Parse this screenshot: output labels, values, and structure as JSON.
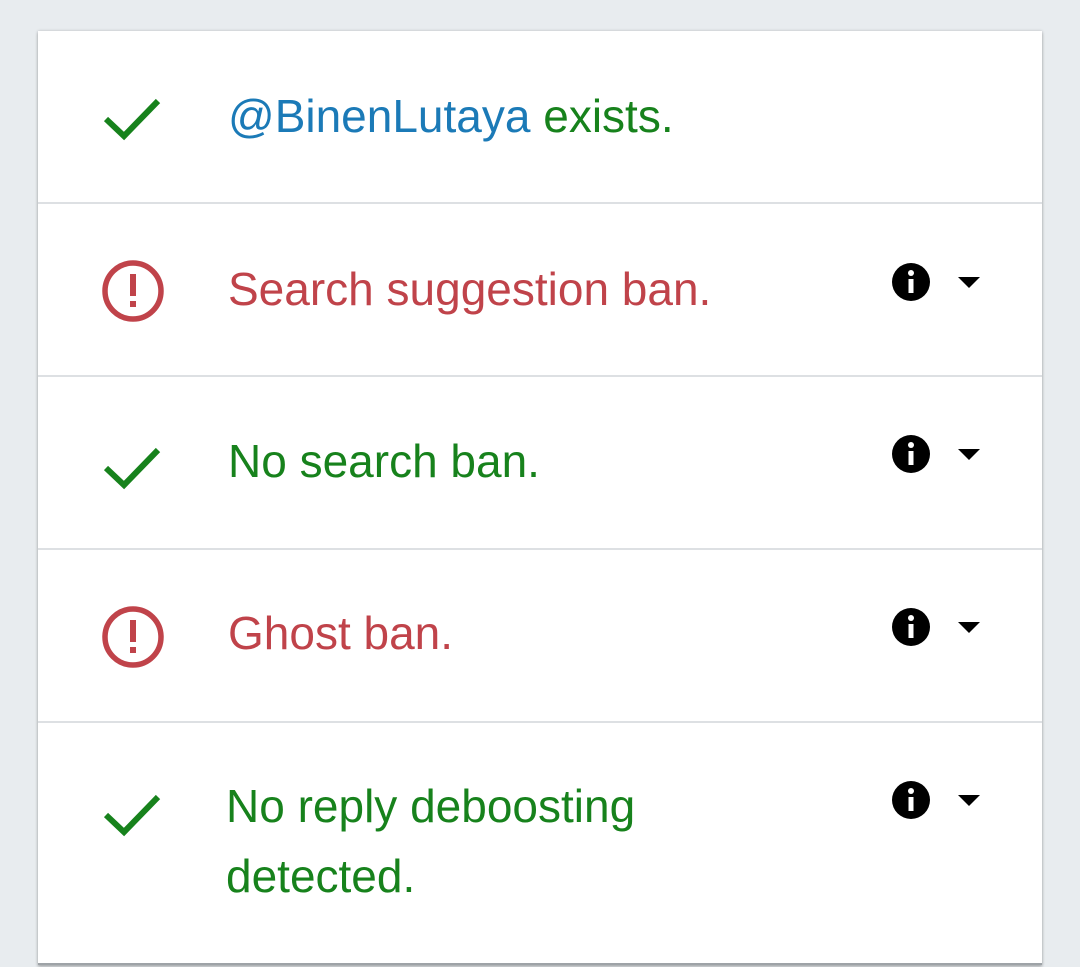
{
  "colors": {
    "ok": "#17821c",
    "warn": "#c0434a",
    "handle": "#1b7ab7"
  },
  "rows": [
    {
      "status": "ok",
      "icon": "check-icon",
      "handle": "@BinenLutaya",
      "text": " exists.",
      "has_details": false
    },
    {
      "status": "warn",
      "icon": "alert-circle-icon",
      "text": "Search suggestion ban.",
      "has_details": true
    },
    {
      "status": "ok",
      "icon": "check-icon",
      "text": "No search ban.",
      "has_details": true
    },
    {
      "status": "warn",
      "icon": "alert-circle-icon",
      "text": "Ghost ban.",
      "has_details": true
    },
    {
      "status": "ok",
      "icon": "check-icon",
      "text_line1": "No reply deboosting",
      "text_line2": "detected.",
      "has_details": true
    }
  ]
}
